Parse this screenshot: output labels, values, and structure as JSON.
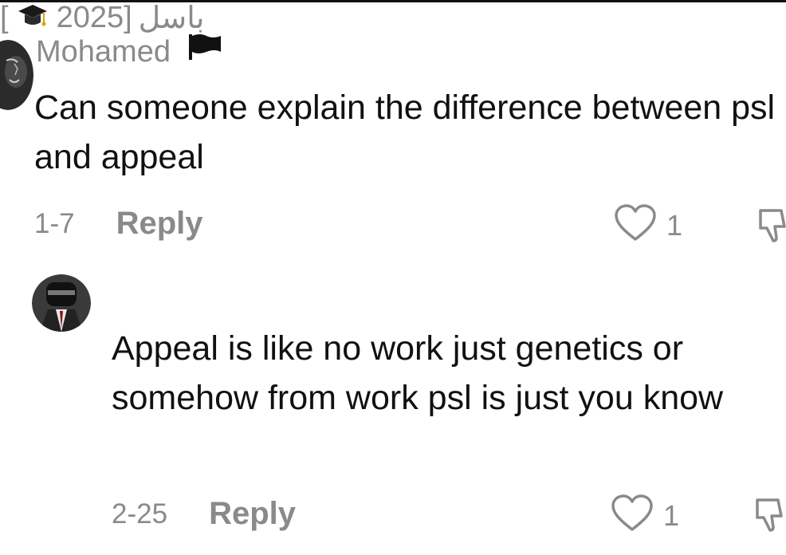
{
  "comments": [
    {
      "username": "Mohamed",
      "username_icon": "black-flag-icon",
      "text": "Can someone explain the difference between psl and appeal",
      "date": "1-7",
      "reply_label": "Reply",
      "like_count": "1"
    },
    {
      "username_arabic": "باسل",
      "username_tag_open": "[",
      "username_tag_icon": "graduation-cap-icon",
      "username_tag_year": "2025]",
      "text": "Appeal is like no work just genetics or somehow from work psl is just you know",
      "date": "2-25",
      "reply_label": "Reply",
      "like_count": "1"
    }
  ],
  "icons": {
    "like": "heart-outline-icon",
    "dislike": "thumbs-down-outline-icon"
  },
  "colors": {
    "text": "#111111",
    "muted": "#8a8a8a",
    "background": "#ffffff"
  }
}
